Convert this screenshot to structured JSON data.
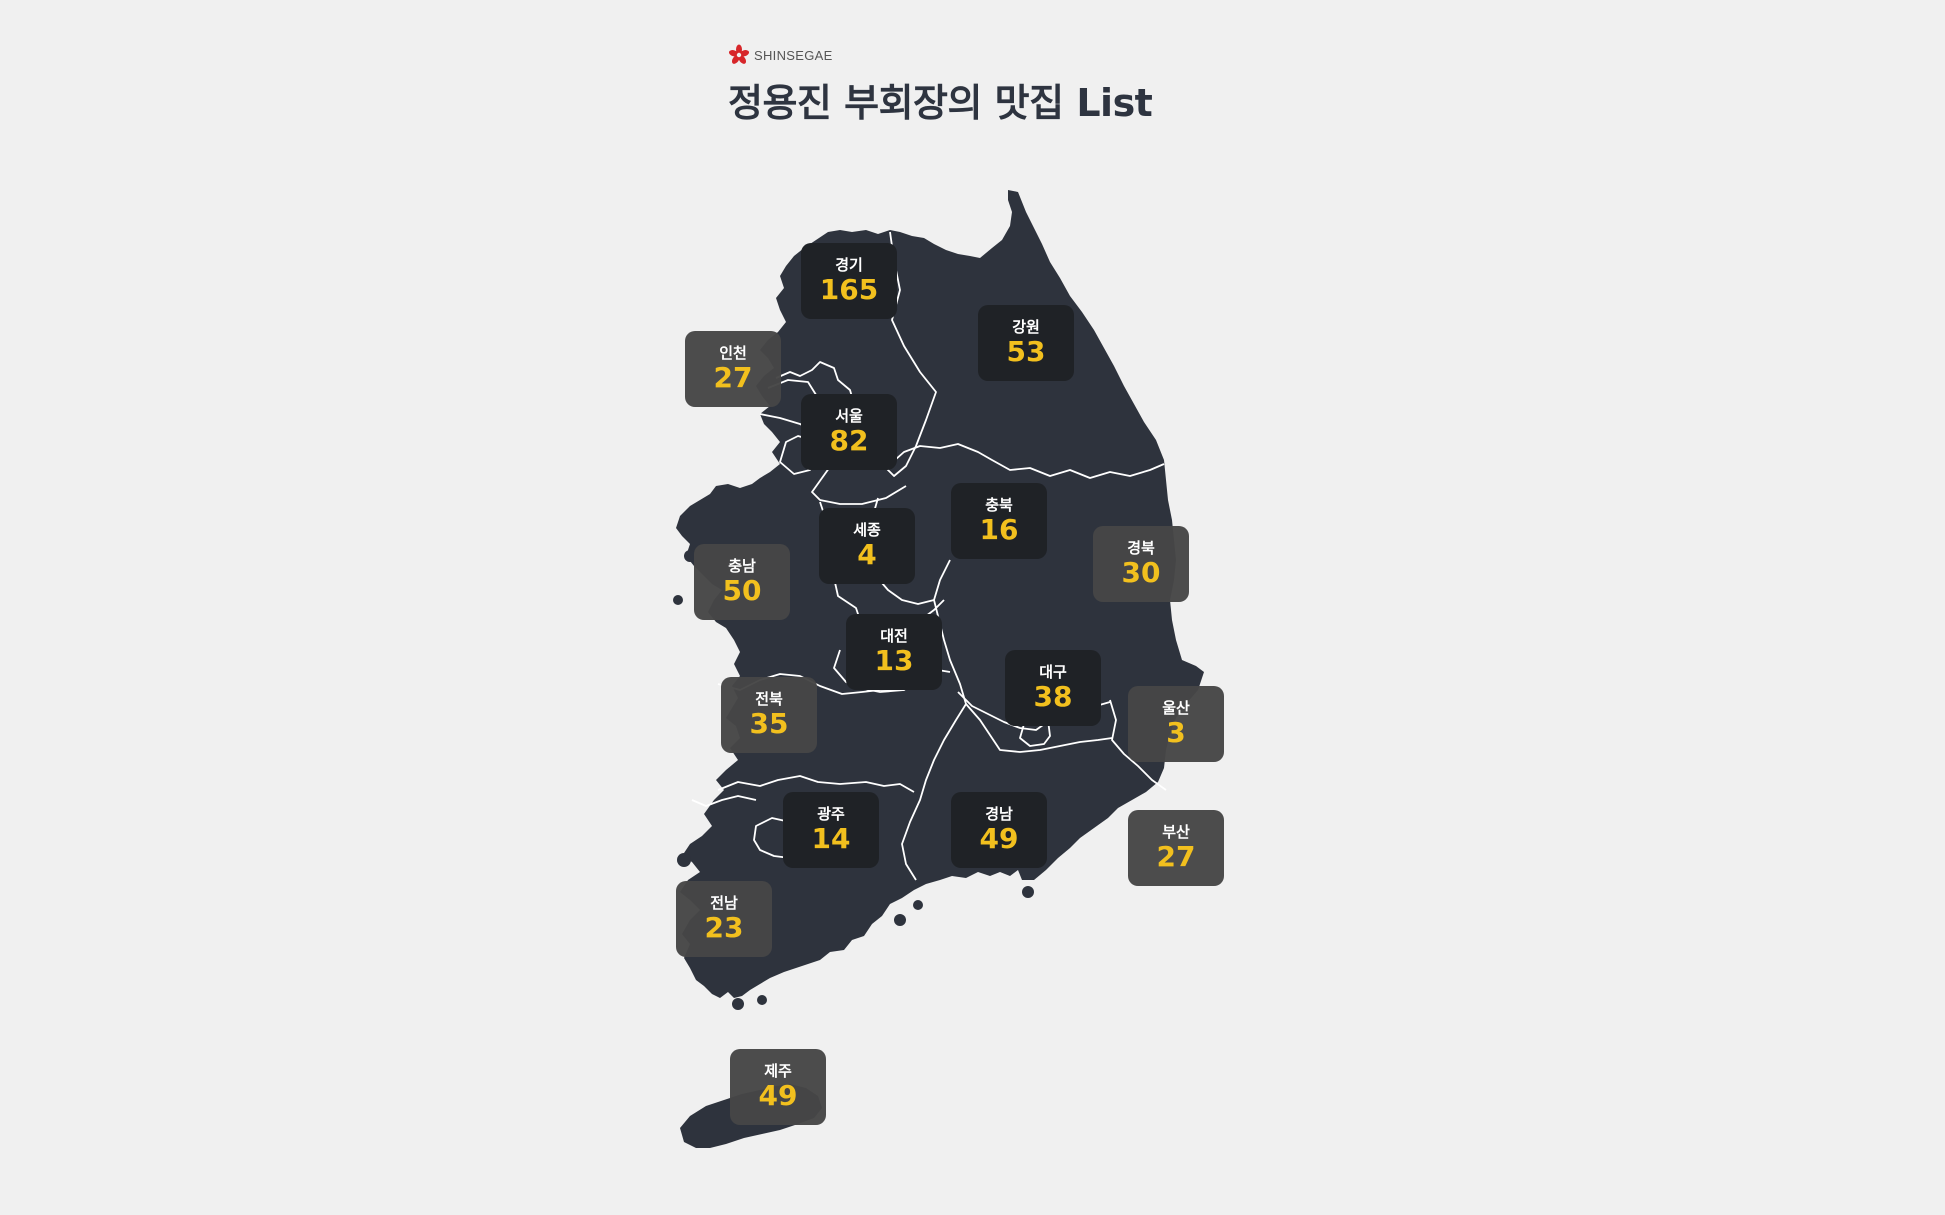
{
  "brand": {
    "name": "SHINSEGAE",
    "logo_color": "#d7262a"
  },
  "title": "정용진 부회장의 맛집 List",
  "colors": {
    "background": "#f0f0f0",
    "land": "#2e333d",
    "border": "#ffffff",
    "count": "#f2c01e"
  },
  "regions": [
    {
      "id": "gyeonggi",
      "name": "경기",
      "count": "165"
    },
    {
      "id": "gangwon",
      "name": "강원",
      "count": "53"
    },
    {
      "id": "incheon",
      "name": "인천",
      "count": "27"
    },
    {
      "id": "seoul",
      "name": "서울",
      "count": "82"
    },
    {
      "id": "chungbuk",
      "name": "충북",
      "count": "16"
    },
    {
      "id": "sejong",
      "name": "세종",
      "count": "4"
    },
    {
      "id": "gyeongbuk",
      "name": "경북",
      "count": "30"
    },
    {
      "id": "chungnam",
      "name": "충남",
      "count": "50"
    },
    {
      "id": "daejeon",
      "name": "대전",
      "count": "13"
    },
    {
      "id": "daegu",
      "name": "대구",
      "count": "38"
    },
    {
      "id": "ulsan",
      "name": "울산",
      "count": "3"
    },
    {
      "id": "jeonbuk",
      "name": "전북",
      "count": "35"
    },
    {
      "id": "gwangju",
      "name": "광주",
      "count": "14"
    },
    {
      "id": "gyeongnam",
      "name": "경남",
      "count": "49"
    },
    {
      "id": "busan",
      "name": "부산",
      "count": "27"
    },
    {
      "id": "jeonnam",
      "name": "전남",
      "count": "23"
    },
    {
      "id": "jeju",
      "name": "제주",
      "count": "49"
    }
  ]
}
